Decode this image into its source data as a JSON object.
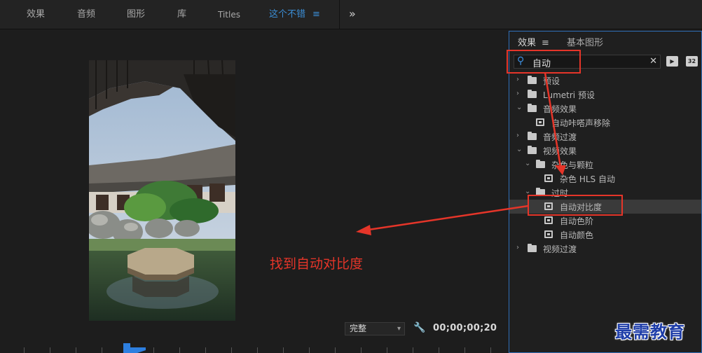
{
  "workspace_tabs": [
    {
      "label": "效果"
    },
    {
      "label": "音频"
    },
    {
      "label": "图形"
    },
    {
      "label": "库"
    },
    {
      "label": "Titles"
    },
    {
      "label": "这个不错",
      "active": true
    }
  ],
  "workspace_menu_glyph": "≡",
  "workspace_more_glyph": "»",
  "program_monitor": {
    "resolution": "完整",
    "timecode": "00;00;00;20",
    "annotation_text": "找到自动对比度"
  },
  "effects_panel": {
    "tabs": [
      {
        "label": "效果",
        "active": true
      },
      {
        "label": "基本图形"
      }
    ],
    "menu_glyph": "≡",
    "search": {
      "value": "自动"
    },
    "filter_buttons": [
      "▶",
      "32"
    ],
    "tree": [
      {
        "label": "预设",
        "type": "folder-star",
        "level": 0,
        "expanded": false
      },
      {
        "label": "Lumetri 预设",
        "type": "folder-star",
        "level": 0,
        "expanded": false
      },
      {
        "label": "音频效果",
        "type": "folder",
        "level": 0,
        "expanded": true
      },
      {
        "label": "自动咔嗒声移除",
        "type": "effect",
        "level": 1
      },
      {
        "label": "音频过渡",
        "type": "folder",
        "level": 0,
        "expanded": false
      },
      {
        "label": "视频效果",
        "type": "folder",
        "level": 0,
        "expanded": true
      },
      {
        "label": "杂色与颗粒",
        "type": "folder",
        "level": 1,
        "expanded": true
      },
      {
        "label": "杂色 HLS 自动",
        "type": "effect",
        "level": 2
      },
      {
        "label": "过时",
        "type": "folder",
        "level": 1,
        "expanded": true
      },
      {
        "label": "自动对比度",
        "type": "effect",
        "level": 2,
        "selected": true
      },
      {
        "label": "自动色阶",
        "type": "effect",
        "level": 2
      },
      {
        "label": "自动颜色",
        "type": "effect",
        "level": 2
      },
      {
        "label": "视频过渡",
        "type": "folder",
        "level": 0,
        "expanded": false
      }
    ]
  },
  "watermark": "最需教育",
  "colors": {
    "accent_blue": "#3b8ed6",
    "annotation_red": "#e53529",
    "panel_border": "#2f6fb8"
  }
}
